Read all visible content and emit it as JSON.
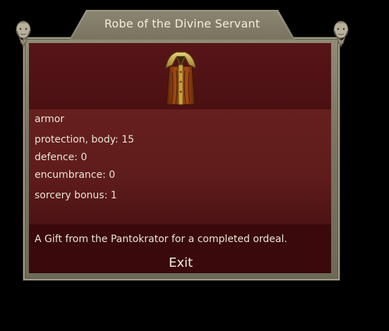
{
  "dialog": {
    "title": "Robe of the Divine Servant",
    "item_icon": "robe-icon",
    "ornament_icon": "bearded-head-icon",
    "properties": {
      "category": "armor",
      "protection": "protection, body: 15",
      "defence": "defence: 0",
      "encumbrance": "encumbrance: 0",
      "sorcery": "sorcery bonus: 1"
    },
    "description": "A Gift from the Pantokrator for a completed ordeal.",
    "exit_label": "Exit"
  },
  "colors": {
    "background": "#000000",
    "frame_stone": "#7f7b67",
    "panel_dark": "#3c0a0d",
    "props_panel": "#5e1c1b",
    "text": "#e9e4d4"
  }
}
